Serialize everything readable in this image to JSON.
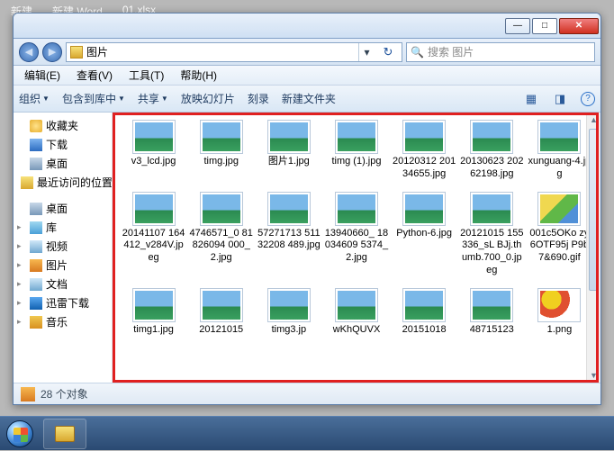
{
  "bg_tasks": [
    "新建",
    "新建 Word",
    "01.xlsx"
  ],
  "title_buttons": {
    "min": "—",
    "max": "□",
    "close": "✕"
  },
  "address": {
    "nav_back": "◀",
    "nav_fwd": "▶",
    "text": "图片",
    "drop": "▾",
    "refresh": "↻"
  },
  "search": {
    "placeholder": "搜索 图片",
    "icon": "🔍"
  },
  "menu": [
    "编辑(E)",
    "查看(V)",
    "工具(T)",
    "帮助(H)"
  ],
  "toolbar": {
    "organize": "组织",
    "include": "包含到库中",
    "share": "共享",
    "slideshow": "放映幻灯片",
    "burn": "刻录",
    "newfolder": "新建文件夹"
  },
  "sidebar": {
    "fav": "收藏夹",
    "downloads": "下载",
    "desktop": "桌面",
    "recent": "最近访问的位置",
    "desktop2": "桌面",
    "libs": "库",
    "video": "视频",
    "pics": "图片",
    "docs": "文档",
    "thunder": "迅雷下载",
    "music": "音乐"
  },
  "files": [
    {
      "name": "v3_lcd.jpg",
      "type": "img"
    },
    {
      "name": "timg.jpg",
      "type": "img"
    },
    {
      "name": "图片1.jpg",
      "type": "img"
    },
    {
      "name": "timg (1).jpg",
      "type": "img"
    },
    {
      "name": "20120312 20134655.jpg",
      "type": "img"
    },
    {
      "name": "20130623 20262198.jpg",
      "type": "img"
    },
    {
      "name": "xunguang-4.jpg",
      "type": "img"
    },
    {
      "name": "20141107 164412_v284V.jpeg",
      "type": "img"
    },
    {
      "name": "4746571_0 81826094 000_2.jpg",
      "type": "img"
    },
    {
      "name": "57271713 51132208 489.jpg",
      "type": "img"
    },
    {
      "name": "13940660_ 18034609 5374_2.jpg",
      "type": "img"
    },
    {
      "name": "Python-6.jpg",
      "type": "img"
    },
    {
      "name": "20121015 155336_sL BJj.thumb.700_0.jpeg",
      "type": "img"
    },
    {
      "name": "001c5OKo zy6OTF95j P9b7&690.gif",
      "type": "gif"
    },
    {
      "name": "timg1.jpg",
      "type": "img"
    },
    {
      "name": "20121015",
      "type": "img"
    },
    {
      "name": "timg3.jp",
      "type": "img"
    },
    {
      "name": "wKhQUVX",
      "type": "img"
    },
    {
      "name": "20151018",
      "type": "img"
    },
    {
      "name": "48715123",
      "type": "img"
    },
    {
      "name": "1.png",
      "type": "png"
    }
  ],
  "status": {
    "count": "28 个对象"
  }
}
